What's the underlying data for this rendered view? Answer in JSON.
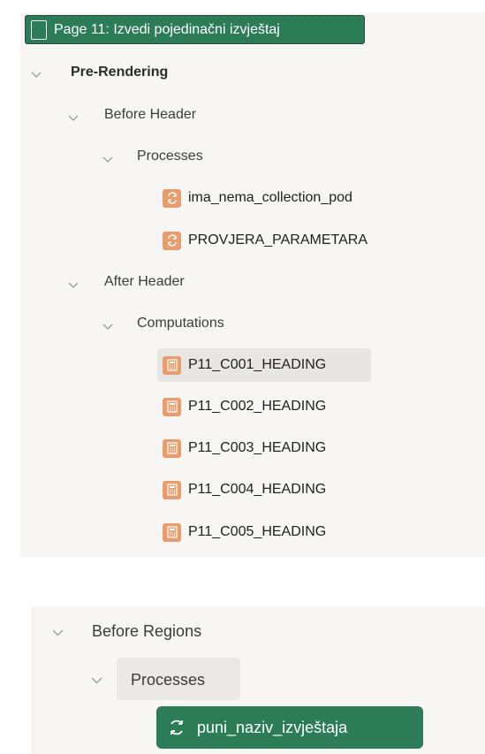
{
  "tree": {
    "page_node": "Page 11: Izvedi pojedinačni izvještaj",
    "pre_rendering": "Pre-Rendering",
    "before_header": "Before Header",
    "before_header_processes": "Processes",
    "before_header_items": [
      "ima_nema_collection_pod",
      "PROVJERA_PARAMETARA"
    ],
    "after_header": "After Header",
    "computations": "Computations",
    "computation_items": [
      "P11_C001_HEADING",
      "P11_C002_HEADING",
      "P11_C003_HEADING",
      "P11_C004_HEADING",
      "P11_C005_HEADING"
    ],
    "before_regions": "Before Regions",
    "before_regions_processes": "Processes",
    "selected_process": "puni_naziv_izvještaja"
  }
}
